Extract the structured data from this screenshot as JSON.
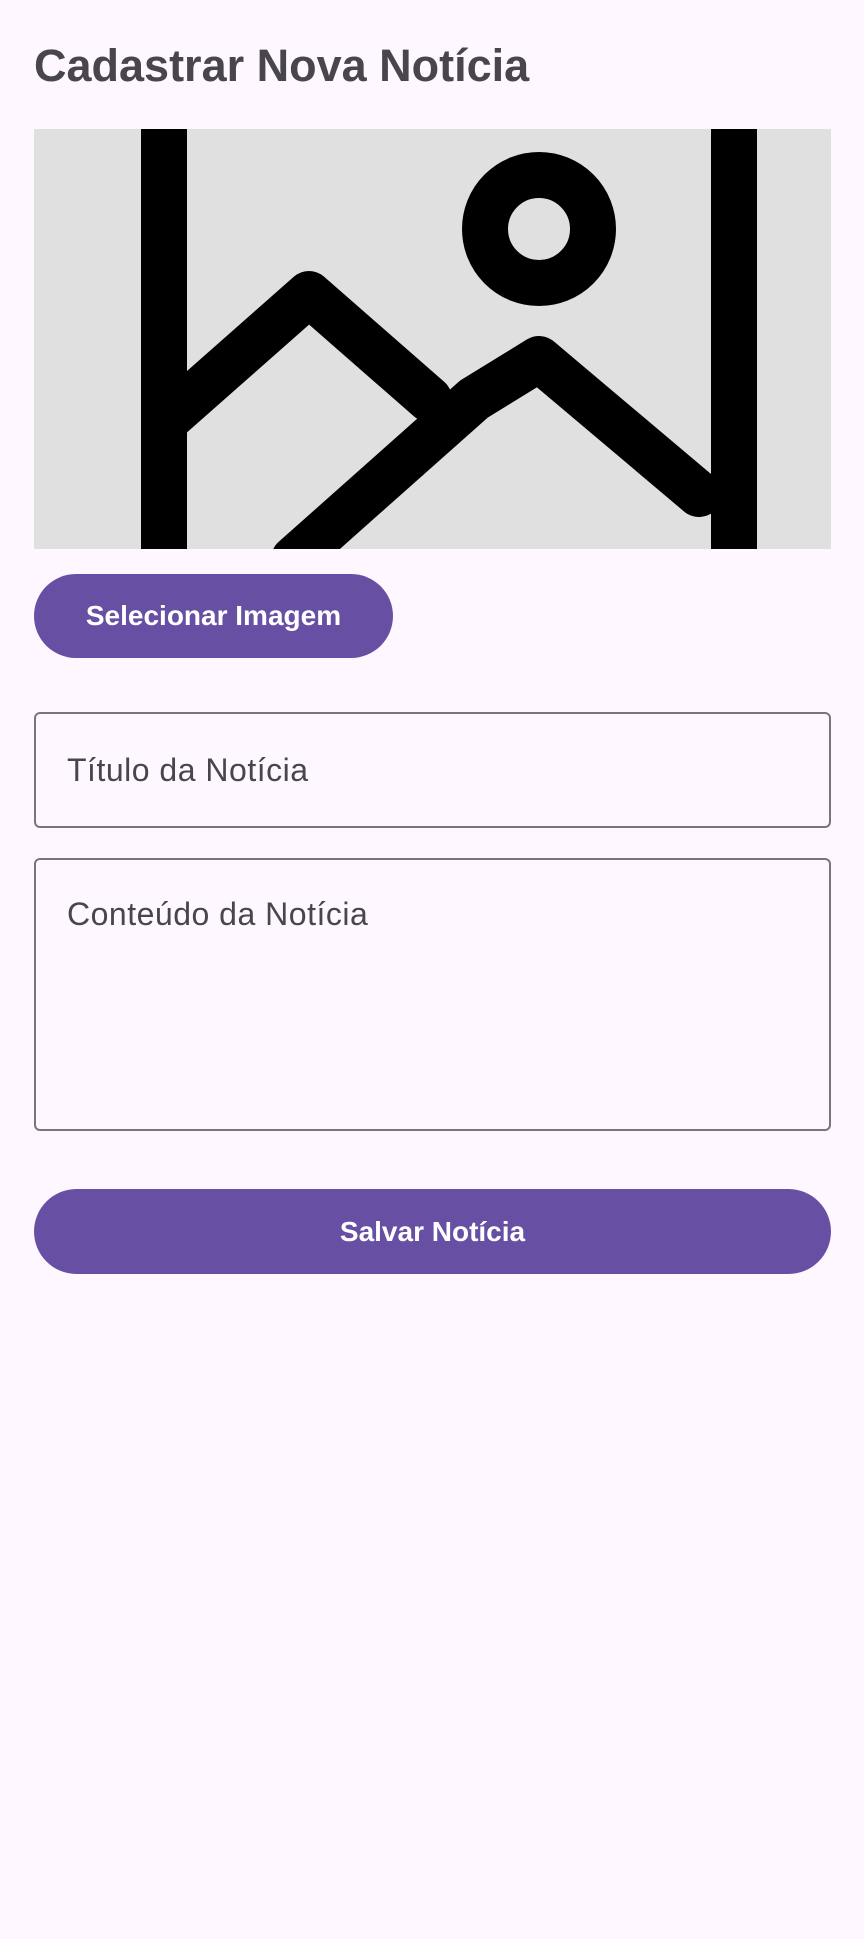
{
  "page": {
    "title": "Cadastrar Nova Notícia"
  },
  "image_preview": {
    "icon": "image-placeholder-icon"
  },
  "buttons": {
    "select_image_label": "Selecionar Imagem",
    "save_label": "Salvar Notícia"
  },
  "form": {
    "title_field": {
      "value": "",
      "placeholder": "Título da Notícia"
    },
    "content_field": {
      "value": "",
      "placeholder": "Conteúdo da Notícia"
    }
  },
  "colors": {
    "background": "#FEF7FF",
    "primary": "#6750A4",
    "on_primary": "#FFFFFF",
    "title_text": "#49454F",
    "outline": "#79747E",
    "image_placeholder_bg": "#E0E0E0"
  }
}
